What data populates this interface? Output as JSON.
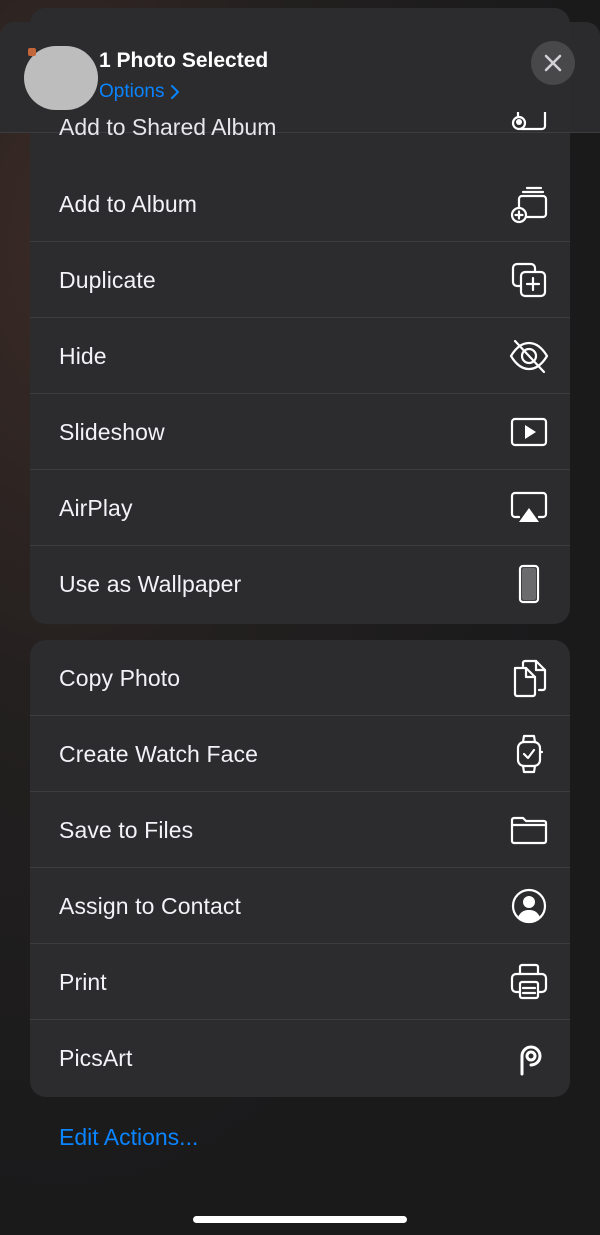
{
  "header": {
    "title": "1 Photo Selected",
    "options_label": "Options",
    "partial_row_label": "Add to Shared Album"
  },
  "group1": [
    {
      "label": "Add to Album",
      "icon": "add-to-album-icon"
    },
    {
      "label": "Duplicate",
      "icon": "duplicate-icon"
    },
    {
      "label": "Hide",
      "icon": "eye-slash-icon"
    },
    {
      "label": "Slideshow",
      "icon": "play-rectangle-icon"
    },
    {
      "label": "AirPlay",
      "icon": "airplay-icon"
    },
    {
      "label": "Use as Wallpaper",
      "icon": "iphone-icon"
    }
  ],
  "group2": [
    {
      "label": "Copy Photo",
      "icon": "copy-icon"
    },
    {
      "label": "Create Watch Face",
      "icon": "watch-icon"
    },
    {
      "label": "Save to Files",
      "icon": "folder-icon"
    },
    {
      "label": "Assign to Contact",
      "icon": "person-circle-icon"
    },
    {
      "label": "Print",
      "icon": "printer-icon"
    },
    {
      "label": "PicsArt",
      "icon": "picsart-icon"
    }
  ],
  "footer": {
    "edit_actions_label": "Edit Actions..."
  },
  "colors": {
    "accent": "#0a84ff",
    "sheet_background": "#2c2c2e",
    "text": "#f2f2f7"
  }
}
